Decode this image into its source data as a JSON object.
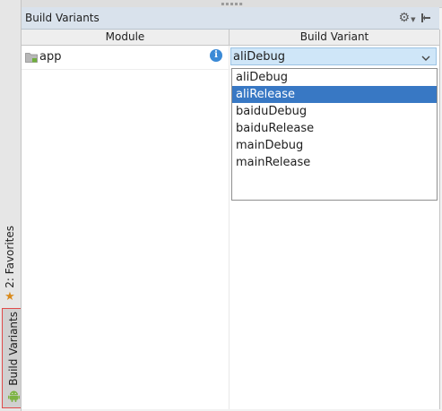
{
  "panel": {
    "title": "Build Variants",
    "gear_icon": "gear-icon",
    "hide_icon": "hide-panel-icon"
  },
  "table": {
    "columns": [
      "Module",
      "Build Variant"
    ],
    "rows": [
      {
        "module": "app",
        "variant": "aliDebug",
        "module_icon": "folder-icon",
        "info_icon": "info-icon"
      }
    ]
  },
  "dropdown": {
    "selected_index": 1,
    "options": [
      "aliDebug",
      "aliRelease",
      "baiduDebug",
      "baiduRelease",
      "mainDebug",
      "mainRelease"
    ]
  },
  "side_tabs": [
    {
      "label": "2: Favorites",
      "icon": "star-icon"
    },
    {
      "label": "Build Variants",
      "icon": "android-icon",
      "active": true
    }
  ],
  "colors": {
    "title_bar": "#d9e2ec",
    "select_bg": "#cfe6f8",
    "selection": "#3878c4",
    "highlight_border": "#e04b4b",
    "star": "#d98a1c",
    "android": "#7cb342",
    "info": "#3b8ad6"
  }
}
